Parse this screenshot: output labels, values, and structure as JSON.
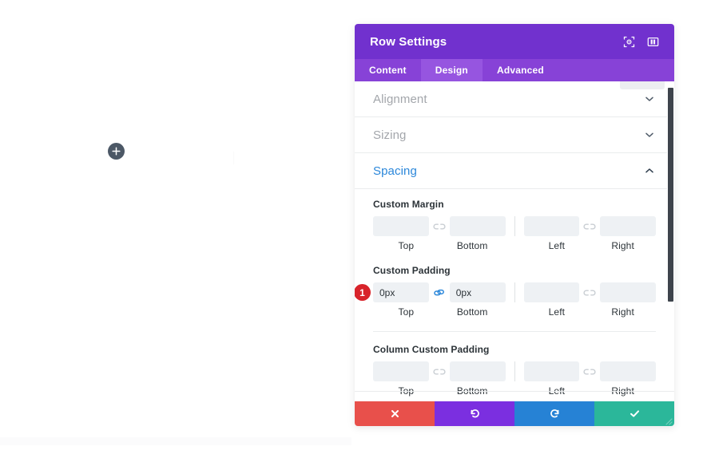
{
  "canvas": {
    "add_row_icon": "plus-icon"
  },
  "modal": {
    "title": "Row Settings",
    "header_icons": [
      {
        "name": "target-icon"
      },
      {
        "name": "layout-panel-icon"
      }
    ],
    "tabs": [
      {
        "label": "Content",
        "active": false
      },
      {
        "label": "Design",
        "active": true
      },
      {
        "label": "Advanced",
        "active": false
      }
    ],
    "sections": [
      {
        "title": "Alignment",
        "open": false,
        "chevron": "chevron-down-icon"
      },
      {
        "title": "Sizing",
        "open": false,
        "chevron": "chevron-down-icon"
      },
      {
        "title": "Spacing",
        "open": true,
        "chevron": "chevron-up-icon"
      }
    ],
    "spacing": {
      "custom_margin": {
        "label": "Custom Margin",
        "badge": "",
        "link_left": "link-broken-icon",
        "link_right": "link-broken-icon",
        "linked": false,
        "fields": [
          {
            "label": "Top",
            "value": "",
            "placeholder": ""
          },
          {
            "label": "Bottom",
            "value": "",
            "placeholder": ""
          },
          {
            "label": "Left",
            "value": "",
            "placeholder": ""
          },
          {
            "label": "Right",
            "value": "",
            "placeholder": ""
          }
        ]
      },
      "custom_padding": {
        "label": "Custom Padding",
        "badge": "1",
        "link_left": "link-connected-icon",
        "link_right": "link-broken-icon",
        "linked": true,
        "fields": [
          {
            "label": "Top",
            "value": "0px",
            "placeholder": ""
          },
          {
            "label": "Bottom",
            "value": "0px",
            "placeholder": ""
          },
          {
            "label": "Left",
            "value": "",
            "placeholder": ""
          },
          {
            "label": "Right",
            "value": "",
            "placeholder": ""
          }
        ]
      },
      "column_custom_padding": {
        "label": "Column Custom Padding",
        "badge": "",
        "link_left": "link-broken-icon",
        "link_right": "link-broken-icon",
        "linked": false,
        "fields": [
          {
            "label": "Top",
            "value": "",
            "placeholder": ""
          },
          {
            "label": "Bottom",
            "value": "",
            "placeholder": ""
          },
          {
            "label": "Left",
            "value": "",
            "placeholder": ""
          },
          {
            "label": "Right",
            "value": "",
            "placeholder": ""
          }
        ]
      }
    },
    "footer_buttons": [
      {
        "name": "cancel-button",
        "icon": "close-icon",
        "color": "#e8504b"
      },
      {
        "name": "undo-button",
        "icon": "undo-icon",
        "color": "#7b2fe0"
      },
      {
        "name": "redo-button",
        "icon": "redo-icon",
        "color": "#2682d5"
      },
      {
        "name": "save-button",
        "icon": "checkmark-icon",
        "color": "#2bb79a"
      }
    ]
  },
  "colors": {
    "header_purple": "#7131ce",
    "tabs_purple": "#8742d7",
    "tab_active_purple": "#9655e0",
    "accent_blue": "#2b87da",
    "badge_red": "#d8232a",
    "input_bg": "#eef1f4"
  }
}
